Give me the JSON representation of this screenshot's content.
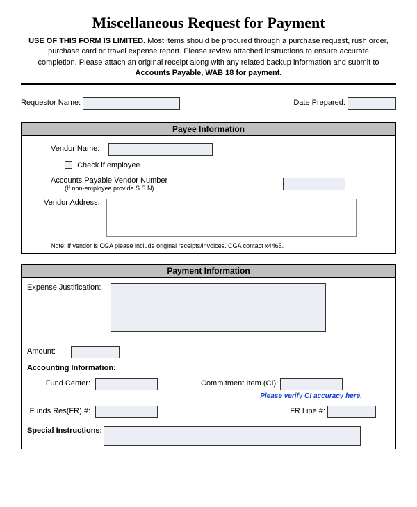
{
  "title": "Miscellaneous Request for Payment",
  "intro": {
    "lead": "USE OF THIS FORM IS LIMITED.",
    "body": " Most items should be procured through a purchase request, rush order, purchase card or travel expense report. Please review attached instructions to ensure accurate completion. Please attach an original receipt along with any related backup information and submit to ",
    "tail": "Accounts Payable, WAB 18 for payment."
  },
  "top": {
    "requestor_label": "Requestor Name:",
    "date_label": "Date Prepared:"
  },
  "payee": {
    "header": "Payee Information",
    "vendor_name_label": "Vendor Name:",
    "employee_check_label": "Check if employee",
    "apvn_label": "Accounts Payable Vendor Number",
    "apvn_sub": "(If non-employee provide S.S.N)",
    "vendor_address_label": "Vendor Address:",
    "note": "Note: If vendor is CGA please include original receipts/invoices. CGA contact x4465."
  },
  "payment": {
    "header": "Payment Information",
    "expense_label": "Expense Justification:",
    "amount_label": "Amount:",
    "accounting_label": "Accounting Information:",
    "fund_center_label": "Fund Center:",
    "commitment_label": "Commitment Item (CI):",
    "verify_link": "Please verify CI accuracy here.",
    "funds_res_label": "Funds Res(FR) #:",
    "fr_line_label": "FR Line #:",
    "special_label": "Special Instructions:"
  }
}
